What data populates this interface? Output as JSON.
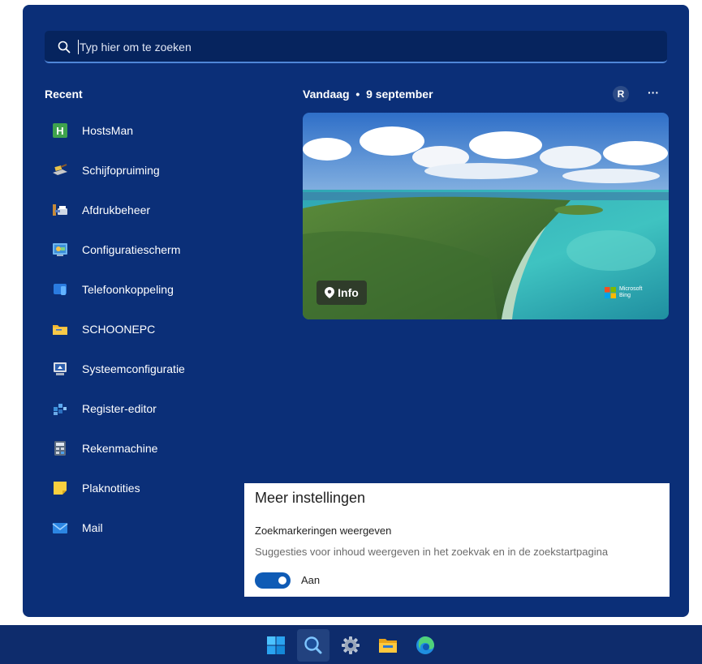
{
  "search": {
    "placeholder": "Typ hier om te zoeken",
    "icon": "search-icon"
  },
  "recent": {
    "heading": "Recent",
    "items": [
      {
        "label": "HostsMan",
        "icon": "hostsman-icon"
      },
      {
        "label": "Schijfopruiming",
        "icon": "disk-cleanup-icon"
      },
      {
        "label": "Afdrukbeheer",
        "icon": "print-management-icon"
      },
      {
        "label": "Configuratiescherm",
        "icon": "control-panel-icon"
      },
      {
        "label": "Telefoonkoppeling",
        "icon": "phone-link-icon"
      },
      {
        "label": "SCHOONEPC",
        "icon": "folder-icon"
      },
      {
        "label": "Systeemconfiguratie",
        "icon": "system-configuration-icon"
      },
      {
        "label": "Register-editor",
        "icon": "registry-editor-icon"
      },
      {
        "label": "Rekenmachine",
        "icon": "calculator-icon"
      },
      {
        "label": "Plaknotities",
        "icon": "sticky-notes-icon"
      },
      {
        "label": "Mail",
        "icon": "mail-icon"
      }
    ]
  },
  "today": {
    "heading": "Vandaag",
    "separator": "•",
    "date": "9 september",
    "avatar_initial": "R",
    "more_label": "···",
    "info_label": "Info",
    "bing_line1": "Microsoft",
    "bing_line2": "Bing"
  },
  "settings": {
    "title": "Meer instellingen",
    "setting_name": "Zoekmarkeringen weergeven",
    "setting_description": "Suggesties voor inhoud weergeven in het zoekvak en in de  zoekstartpagina",
    "toggle_label": "Aan",
    "toggle_on": true
  },
  "taskbar": {
    "items": [
      "windows-start-icon",
      "search-icon",
      "settings-gear-icon",
      "file-explorer-icon",
      "edge-browser-icon"
    ]
  },
  "colors": {
    "panel_bg": "#0b2f78",
    "search_bg": "#06245e",
    "accent": "#0f5bb5",
    "taskbar_bg": "#0e2c6c"
  }
}
